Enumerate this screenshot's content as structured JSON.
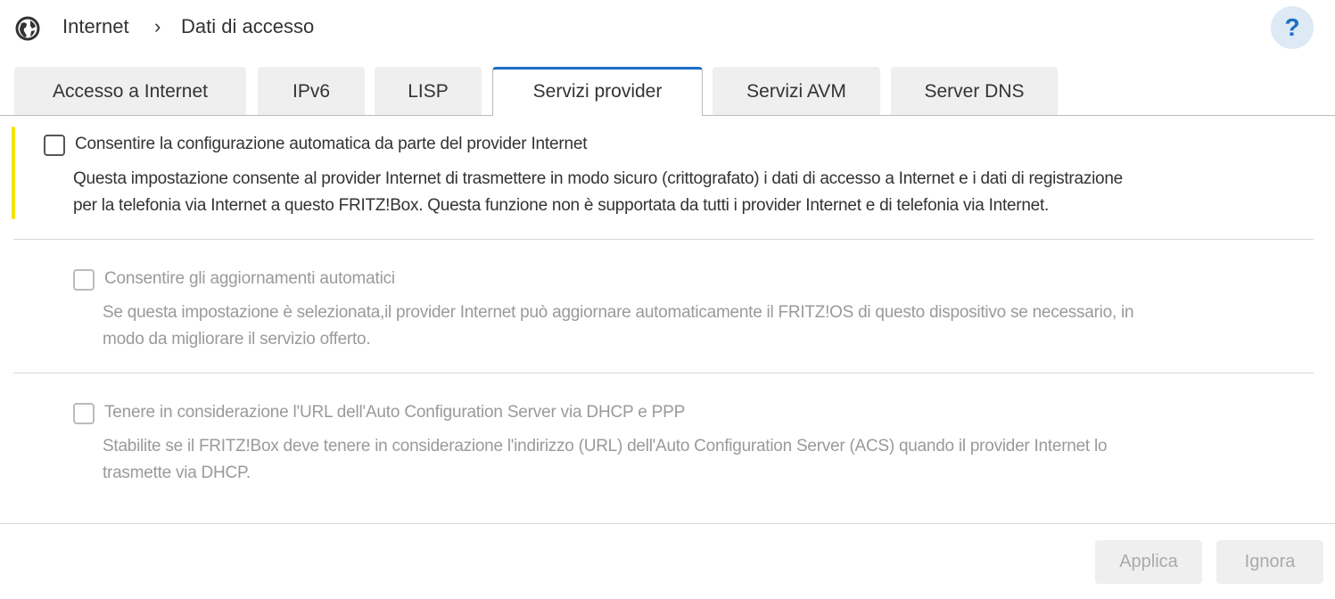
{
  "breadcrumb": {
    "icon": "globe-icon",
    "root": "Internet",
    "separator": "›",
    "current": "Dati di accesso"
  },
  "help": {
    "label": "?"
  },
  "tabs": [
    {
      "label": "Accesso a Internet",
      "active": false
    },
    {
      "label": "IPv6",
      "active": false
    },
    {
      "label": "LISP",
      "active": false
    },
    {
      "label": "Servizi provider",
      "active": true
    },
    {
      "label": "Servizi AVM",
      "active": false
    },
    {
      "label": "Server DNS",
      "active": false
    }
  ],
  "options": [
    {
      "label": "Consentire la configurazione automatica da parte del provider Internet",
      "checked": false,
      "enabled": true,
      "desc1": "Questa impostazione consente al provider Internet di trasmettere in modo sicuro (crittografato) i dati di accesso a Internet e i dati di registrazione",
      "desc2": "per la telefonia via Internet a questo FRITZ!Box. Questa funzione non è supportata da tutti i provider Internet e di telefonia via Internet."
    },
    {
      "label": "Consentire gli aggiornamenti automatici",
      "checked": false,
      "enabled": false,
      "desc1": "Se questa impostazione è selezionata,il provider Internet può aggiornare automaticamente il FRITZ!OS di questo dispositivo se necessario, in",
      "desc2": "modo da migliorare il servizio offerto."
    },
    {
      "label": "Tenere in considerazione l'URL dell'Auto Configuration Server via DHCP e PPP",
      "checked": false,
      "enabled": false,
      "desc1": "Stabilite se il FRITZ!Box deve tenere in considerazione l'indirizzo (URL) dell'Auto Configuration Server (ACS) quando il provider Internet lo",
      "desc2": "trasmette via DHCP."
    }
  ],
  "buttons": {
    "apply": "Applica",
    "cancel": "Ignora"
  },
  "colors": {
    "accent": "#1a6fc4",
    "highlight": "#f5e400"
  }
}
